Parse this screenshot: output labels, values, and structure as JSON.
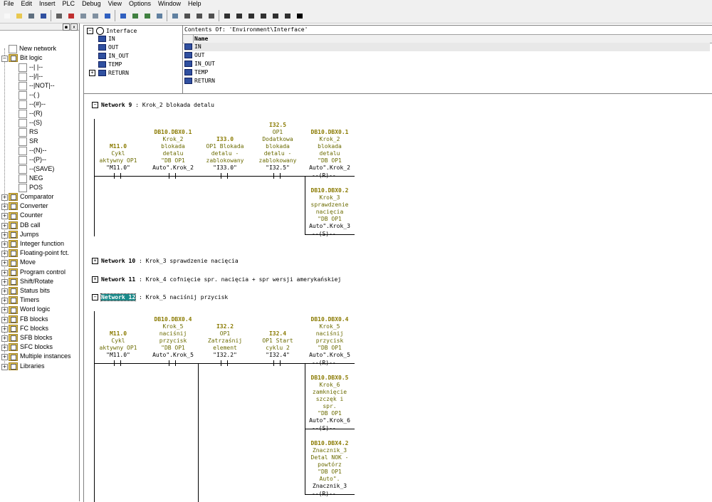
{
  "menu": [
    "File",
    "Edit",
    "Insert",
    "PLC",
    "Debug",
    "View",
    "Options",
    "Window",
    "Help"
  ],
  "left_close": "x",
  "tree": {
    "root_items": [
      {
        "label": "New network",
        "icon": "new-network-icon"
      },
      {
        "label": "Bit logic",
        "icon": "bit-logic-folder-icon",
        "expanded": true
      }
    ],
    "bit_logic": [
      "--| |--",
      "--|/|--",
      "--|NOT|--",
      "--( )",
      "--(#)--",
      "--(R)",
      "--(S)",
      "RS",
      "SR",
      "--(N)--",
      "--(P)--",
      "--(SAVE)",
      "NEG",
      "POS"
    ],
    "folders": [
      "Comparator",
      "Converter",
      "Counter",
      "DB call",
      "Jumps",
      "Integer function",
      "Floating-point fct.",
      "Move",
      "Program control",
      "Shift/Rotate",
      "Status bits",
      "Timers",
      "Word logic",
      "FB blocks",
      "FC blocks",
      "SFB blocks",
      "SFC blocks",
      "Multiple instances",
      "Libraries"
    ]
  },
  "interface": {
    "root": "Interface",
    "items": [
      "IN",
      "OUT",
      "IN_OUT",
      "TEMP",
      "RETURN"
    ]
  },
  "contents": {
    "title": "Contents Of: 'Environment\\Interface'",
    "column": "Name",
    "items": [
      "IN",
      "OUT",
      "IN_OUT",
      "TEMP",
      "RETURN"
    ]
  },
  "networks": {
    "n9": {
      "label": "Network 9",
      "title": "Krok_2 blokada detalu",
      "contacts": [
        {
          "addr": "M11.0",
          "lines": [
            "Cykl",
            "aktywny OP1"
          ],
          "sym": "\"M11.0\""
        },
        {
          "addr": "DB10.DBX0.1",
          "lines": [
            "Krok_2",
            "blokada",
            "detalu",
            "\"DB OP1"
          ],
          "sym": "Auto\".Krok_2"
        },
        {
          "addr": "I33.0",
          "lines": [
            "OP1 Blokada",
            "detalu -",
            "zablokowany"
          ],
          "sym": "\"I33.0\""
        },
        {
          "addr": "I32.5",
          "lines": [
            "OP1",
            "Dodatkowa",
            "blokada",
            "detalu -",
            "zablokowany"
          ],
          "sym": "\"I32.5\""
        }
      ],
      "coils": [
        {
          "addr": "DB10.DBX0.1",
          "lines": [
            "Krok_2",
            "blokada",
            "detalu",
            "\"DB OP1"
          ],
          "sym": "Auto\".Krok_2",
          "type": "--(R)--"
        },
        {
          "addr": "DB10.DBX0.2",
          "lines": [
            "Krok_3",
            "sprawdzenie",
            "nacięcia",
            "\"DB OP1"
          ],
          "sym": "Auto\".Krok_3",
          "type": "--(S)--"
        }
      ]
    },
    "n10": {
      "label": "Network 10",
      "title": "Krok_3 sprawdzenie nacięcia"
    },
    "n11": {
      "label": "Network 11",
      "title": "Krok_4 cofnięcie spr. nacięcia + spr wersji amerykańskiej"
    },
    "n12": {
      "label": "Network 12",
      "title": "Krok_5 naciśnij przycisk",
      "contacts": [
        {
          "addr": "M11.0",
          "lines": [
            "Cykl",
            "aktywny OP1"
          ],
          "sym": "\"M11.0\""
        },
        {
          "addr": "DB10.DBX0.4",
          "lines": [
            "Krok_5",
            "naciśnij",
            "przycisk",
            "\"DB OP1"
          ],
          "sym": "Auto\".Krok_5"
        },
        {
          "addr": "I32.2",
          "lines": [
            "OP1",
            "Zatrzaśnij",
            "element"
          ],
          "sym": "\"I32.2\""
        },
        {
          "addr": "I32.4",
          "lines": [
            "OP1 Start",
            "cyklu 2"
          ],
          "sym": "\"I32.4\""
        }
      ],
      "coils": [
        {
          "addr": "DB10.DBX0.4",
          "lines": [
            "Krok_5",
            "naciśnij",
            "przycisk",
            "\"DB OP1"
          ],
          "sym": "Auto\".Krok_5",
          "type": "--(R)--"
        },
        {
          "addr": "DB10.DBX0.5",
          "lines": [
            "Krok_6",
            "zamknięcie",
            "szczęk i",
            "spr.",
            "\"DB OP1"
          ],
          "sym": "Auto\".Krok_6",
          "type": "--(S)--"
        },
        {
          "addr": "DB10.DBX4.2",
          "lines": [
            "Znacznik_3",
            "Detal NOK -",
            "powtórz",
            "\"DB OP1",
            "Auto\"."
          ],
          "sym": "Znacznik_3",
          "type": "--(R)--"
        }
      ]
    }
  }
}
